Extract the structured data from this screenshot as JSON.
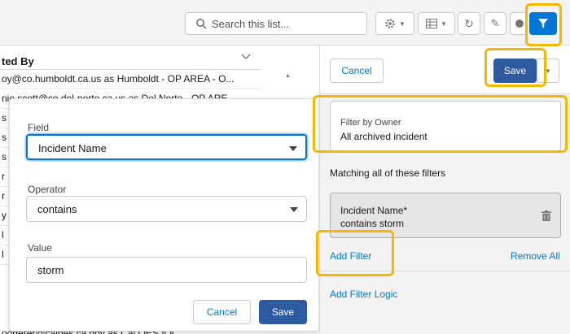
{
  "toolbar": {
    "search_placeholder": "Search this list...",
    "icons": [
      "search-icon",
      "gear-icon",
      "table-icon",
      "refresh-icon",
      "edit-icon",
      "chart-icon",
      "filter-icon"
    ]
  },
  "list": {
    "column_title": "ted By",
    "rows": [
      "oy@co.humboldt.ca.us as Humboldt - OP AREA - O...",
      "nie.scott@co.del-norte.ca.us as Del Norte - OP ARE...",
      "s",
      "s",
      "s",
      "r",
      "r",
      "y",
      "l",
      "l",
      "oogerer@caloes.ca.gov as Cal OES IOC"
    ]
  },
  "popover": {
    "field_label": "Field",
    "field_value": "Incident Name",
    "operator_label": "Operator",
    "operator_value": "contains",
    "value_label": "Value",
    "value_value": "storm",
    "cancel_label": "Cancel",
    "save_label": "Save"
  },
  "panel": {
    "cancel_label": "Cancel",
    "save_label": "Save",
    "owner_title": "Filter by Owner",
    "owner_value": "All archived incident",
    "matching_text": "Matching all of these filters",
    "filter_field": "Incident Name*",
    "filter_desc": "contains storm",
    "add_filter": "Add Filter",
    "remove_all": "Remove All",
    "add_filter_logic": "Add Filter Logic"
  },
  "colors": {
    "brand": "#0176d3",
    "save_button": "#2e5a9f",
    "highlight": "#f5b800"
  }
}
